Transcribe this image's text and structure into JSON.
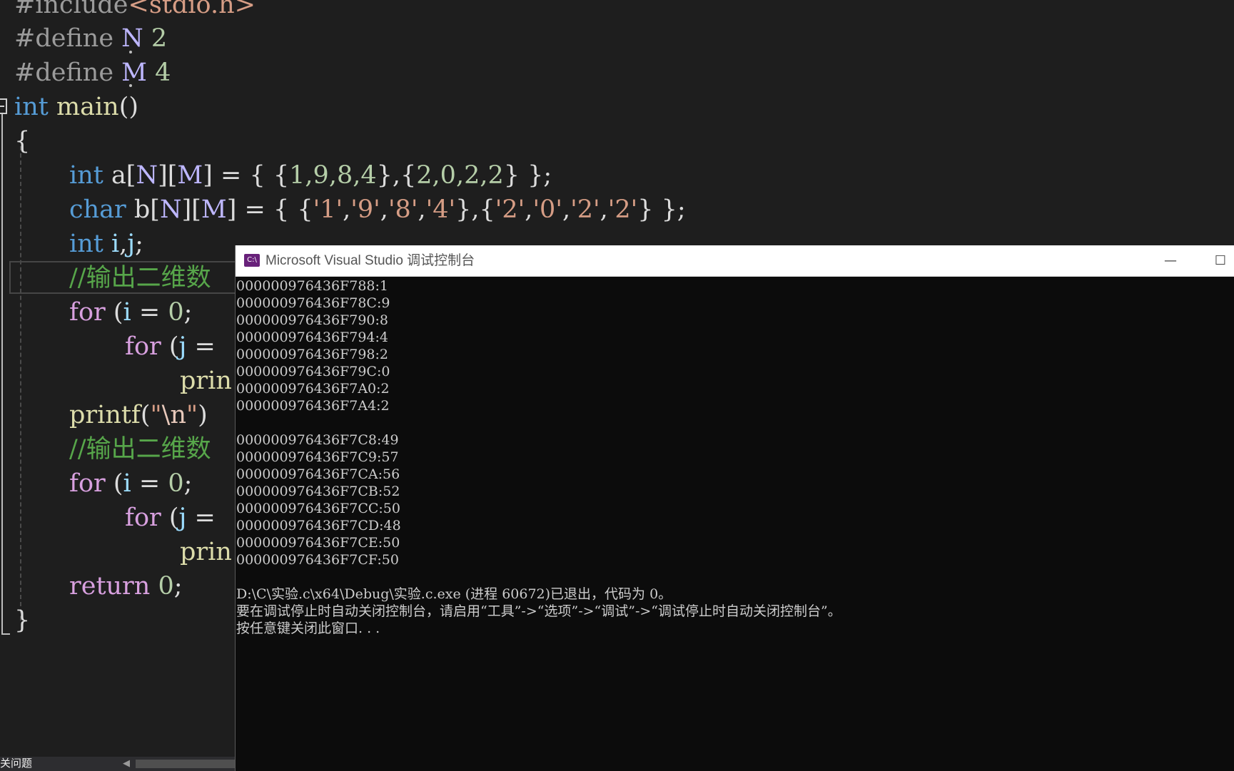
{
  "editor": {
    "lines": {
      "l0": {
        "pp": "#include",
        "str": "<stdio.h>"
      },
      "l1": {
        "pp": "#define ",
        "mac": "N",
        "num": " 2"
      },
      "l2": {
        "pp": "#define ",
        "mac": "M",
        "num": " 4"
      },
      "l3": {
        "kw": "int",
        "fn": " main",
        "plain": "()"
      },
      "l4": {
        "plain": "{"
      },
      "l5": {
        "kw": "int",
        "plain": " a[",
        "mac1": "N",
        "p2": "][",
        "mac2": "M",
        "p3": "] = { {",
        "num": "1,9,8,4",
        "p4": "},{",
        "num2": "2,0,2,2",
        "p5": "} };"
      },
      "l6": {
        "kw": "char",
        "plain": " b[",
        "mac1": "N",
        "p2": "][",
        "mac2": "M",
        "p3": "] = { {",
        "s1": "'1'",
        "c1": ",",
        "s2": "'9'",
        "c2": ",",
        "s3": "'8'",
        "c3": ",",
        "s4": "'4'",
        "p4": "},{",
        "s5": "'2'",
        "c5": ",",
        "s6": "'0'",
        "c6": ",",
        "s7": "'2'",
        "c7": ",",
        "s8": "'2'",
        "p5": "} };"
      },
      "l7": {
        "kw": "int",
        "var": " i",
        "plain": ",",
        "var2": "j",
        "p2": ";"
      },
      "l8": {
        "cmt": "//输出二维数"
      },
      "l9": {
        "ctl": "for",
        "plain": " (",
        "var": "i",
        "p2": " = ",
        "num": "0",
        "p3": ";"
      },
      "l10": {
        "ctl": "for",
        "plain": " (",
        "var": "j",
        "p2": " ="
      },
      "l11": {
        "fn": "prin"
      },
      "l12": {
        "fn": "printf",
        "plain": "(",
        "str": "\"",
        "esc": "\\n",
        "str2": "\"",
        "p2": ")"
      },
      "l13": {
        "cmt": "//输出二维数"
      },
      "l14": {
        "ctl": "for",
        "plain": " (",
        "var": "i",
        "p2": " = ",
        "num": "0",
        "p3": ";"
      },
      "l15": {
        "ctl": "for",
        "plain": " (",
        "var": "j",
        "p2": " ="
      },
      "l16": {
        "fn": "prin"
      },
      "l17": {
        "ctl": "return",
        "num": " 0",
        "plain": ";"
      },
      "l18": {
        "plain": "}"
      }
    }
  },
  "console": {
    "title": "Microsoft Visual Studio 调试控制台",
    "icon_label": "C:\\",
    "minimize": "—",
    "maximize": "☐",
    "output": "000000976436F788:1\n000000976436F78C:9\n000000976436F790:8\n000000976436F794:4\n000000976436F798:2\n000000976436F79C:0\n000000976436F7A0:2\n000000976436F7A4:2\n\n000000976436F7C8:49\n000000976436F7C9:57\n000000976436F7CA:56\n000000976436F7CB:52\n000000976436F7CC:50\n000000976436F7CD:48\n000000976436F7CE:50\n000000976436F7CF:50\n\nD:\\C\\实验.c\\x64\\Debug\\实验.c.exe (进程 60672)已退出，代码为 0。\n要在调试停止时自动关闭控制台，请启用“工具”->“选项”->“调试”->“调试停止时自动关闭控制台”。\n按任意键关闭此窗口. . ."
  },
  "status": {
    "text": "关问题"
  }
}
